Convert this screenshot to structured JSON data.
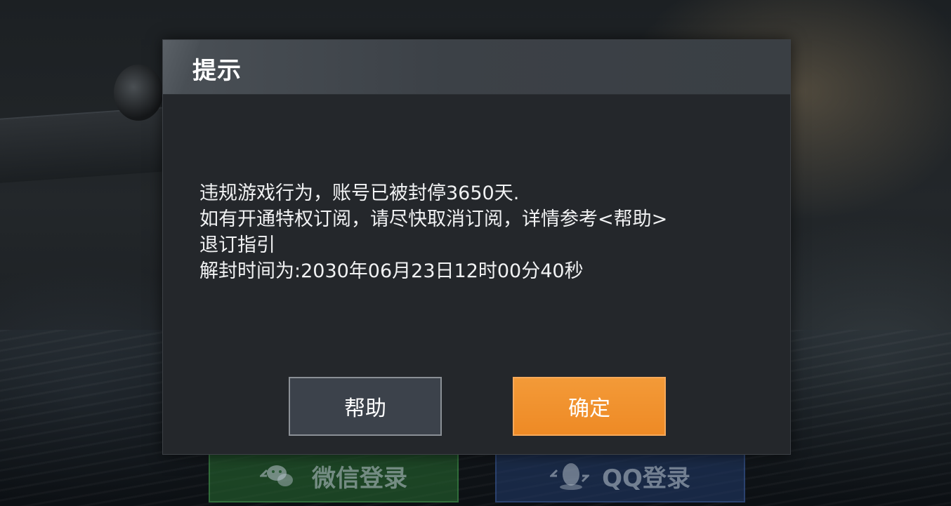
{
  "background": {
    "login_wechat_label": "微信登录",
    "login_qq_label": "QQ登录"
  },
  "dialog": {
    "title": "提示",
    "body_lines": [
      "违规游戏行为，账号已被封停3650天.",
      "如有开通特权订阅，请尽快取消订阅，详情参考<帮助>",
      "退订指引",
      "解封时间为:2030年06月23日12时00分40秒"
    ],
    "help_button_label": "帮助",
    "confirm_button_label": "确定"
  },
  "colors": {
    "dialog_bg": "#24272b",
    "header_bg": "#4a5056",
    "confirm_accent": "#ef8d2a",
    "help_button_bg": "#3c424b"
  },
  "icons": {
    "wechat": "wechat-icon",
    "qq": "qq-icon"
  }
}
